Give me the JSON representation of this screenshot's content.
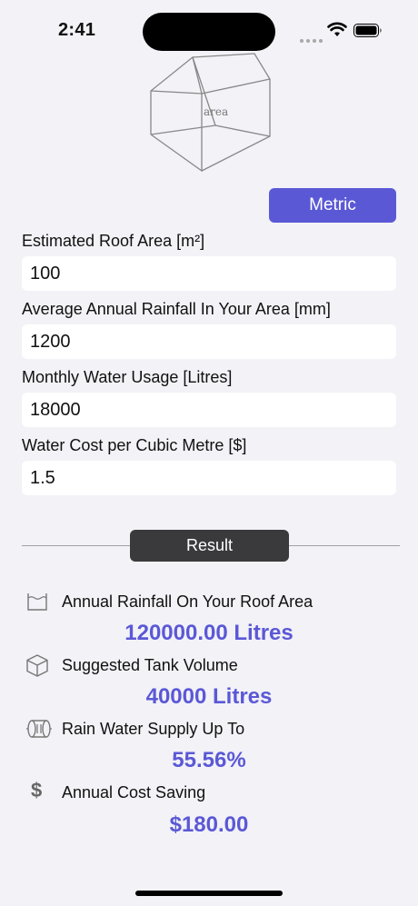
{
  "status": {
    "time": "2:41"
  },
  "header": {
    "image_label": "area"
  },
  "unit_toggle": {
    "label": "Metric"
  },
  "form": {
    "roof_area": {
      "label": "Estimated Roof Area [m²]",
      "value": "100"
    },
    "rainfall": {
      "label": "Average Annual Rainfall In Your Area [mm]",
      "value": "1200"
    },
    "usage": {
      "label": "Monthly Water Usage [Litres]",
      "value": "18000"
    },
    "cost": {
      "label": "Water Cost per Cubic Metre [$]",
      "value": "1.5"
    }
  },
  "result_button": {
    "label": "Result"
  },
  "results": {
    "annual_rainfall": {
      "icon": "container-icon",
      "label": "Annual Rainfall On Your Roof Area",
      "value": "120000.00 Litres"
    },
    "tank_volume": {
      "icon": "cube-icon",
      "label": "Suggested Tank Volume",
      "value": "40000 Litres"
    },
    "supply": {
      "icon": "water-tank-icon",
      "label": "Rain Water Supply Up To",
      "value": "55.56%"
    },
    "saving": {
      "icon": "dollar-icon",
      "label": "Annual Cost Saving",
      "value": "$180.00"
    }
  },
  "colors": {
    "accent": "#5b58d6",
    "result_button": "#3a3a3c",
    "background": "#f2f2f7"
  }
}
